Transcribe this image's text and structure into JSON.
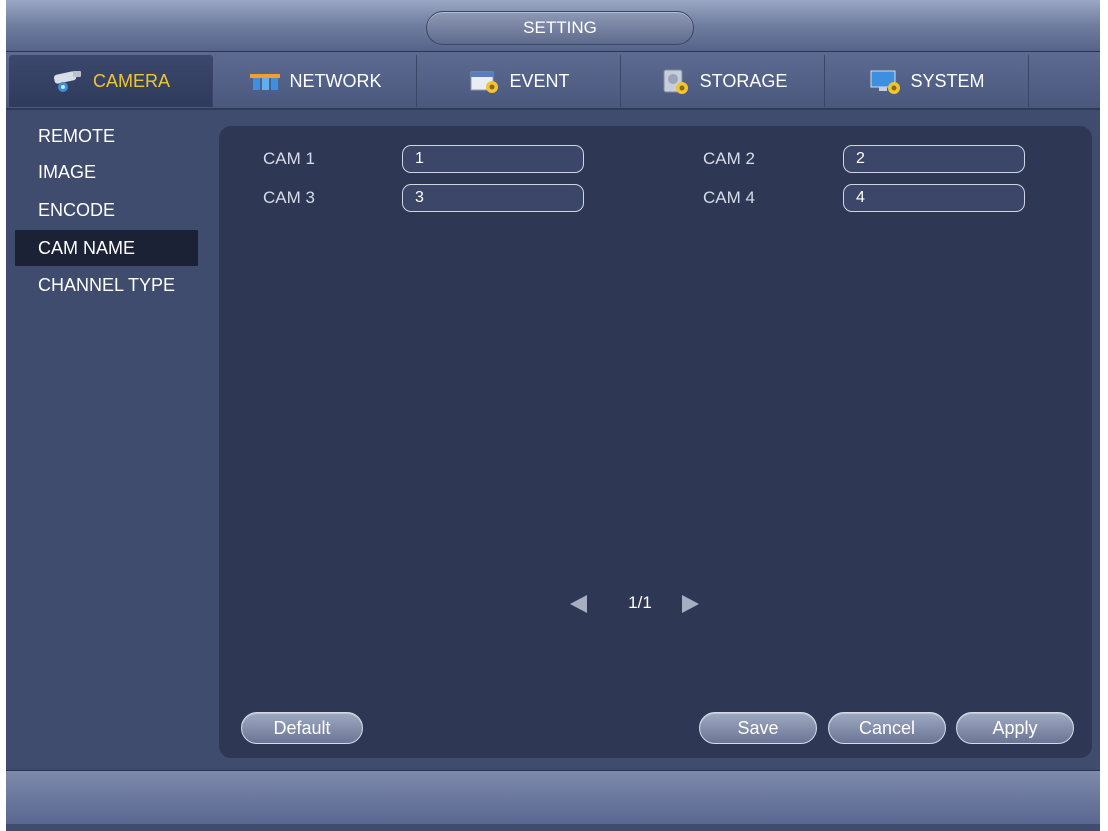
{
  "header": {
    "title": "SETTING"
  },
  "tabs": [
    {
      "label": "CAMERA",
      "icon": "camera-icon",
      "active": true
    },
    {
      "label": "NETWORK",
      "icon": "network-icon",
      "active": false
    },
    {
      "label": "EVENT",
      "icon": "event-icon",
      "active": false
    },
    {
      "label": "STORAGE",
      "icon": "storage-icon",
      "active": false
    },
    {
      "label": "SYSTEM",
      "icon": "system-icon",
      "active": false
    }
  ],
  "sidebar": {
    "items": [
      {
        "label": "REMOTE"
      },
      {
        "label": "IMAGE"
      },
      {
        "label": "ENCODE"
      },
      {
        "label": "CAM NAME",
        "active": true
      },
      {
        "label": "CHANNEL TYPE"
      }
    ]
  },
  "cams": [
    {
      "label": "CAM 1",
      "value": "1"
    },
    {
      "label": "CAM 2",
      "value": "2"
    },
    {
      "label": "CAM 3",
      "value": "3"
    },
    {
      "label": "CAM 4",
      "value": "4"
    }
  ],
  "pager": {
    "text": "1/1"
  },
  "buttons": {
    "default": "Default",
    "save": "Save",
    "cancel": "Cancel",
    "apply": "Apply"
  },
  "colors": {
    "active_tab_text": "#f3c431",
    "panel_bg": "#2e3855",
    "window_bg": "#3f4c6e",
    "selected_item_bg": "#1c2236"
  }
}
